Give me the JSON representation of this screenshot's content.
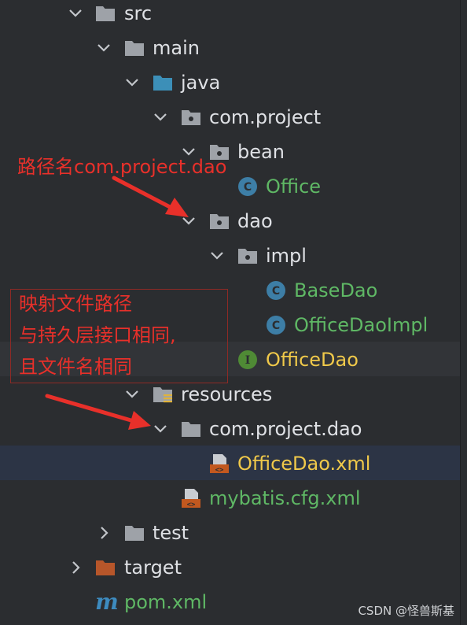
{
  "tree": {
    "src": "src",
    "main": "main",
    "java": "java",
    "pkg_project": "com.project",
    "bean": "bean",
    "office": "Office",
    "dao": "dao",
    "impl": "impl",
    "basedao": "BaseDao",
    "officedaoimpl": "OfficeDaoImpl",
    "officedao": "OfficeDao",
    "resources": "resources",
    "pkg_dao": "com.project.dao",
    "officedao_xml": "OfficeDao.xml",
    "mybatis_xml": "mybatis.cfg.xml",
    "test": "test",
    "target": "target",
    "pom": "pom.xml"
  },
  "icons": {
    "class_badge": "C",
    "interface_badge": "I",
    "xml_badge": "<>",
    "maven_badge": "m"
  },
  "annotations": {
    "path_note": "路径名com.project.dao",
    "mapping_line1": "映射文件路径",
    "mapping_line2": "与持久层接口相同,",
    "mapping_line3": "且文件名相同"
  },
  "watermark": "CSDN @怪兽斯基",
  "colors": {
    "background": "#2b2d30",
    "folder": "#9ea2a8",
    "source_folder": "#3c8fb8",
    "target_folder": "#b7562a",
    "class_icon": "#3d7ea6",
    "interface_icon": "#4f8a35",
    "annotation": "#e8302a"
  }
}
